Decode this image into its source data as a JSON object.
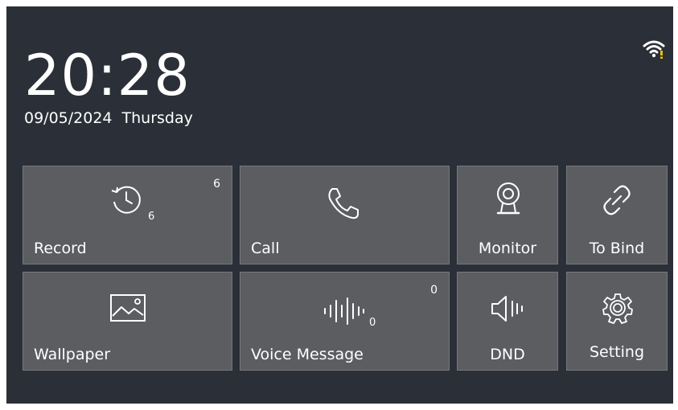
{
  "status": {
    "time": "20:28",
    "date": "09/05/2024",
    "weekday": "Thursday",
    "wifi_icon": "wifi-icon"
  },
  "tiles": {
    "record": {
      "label": "Record",
      "badge": "6",
      "icon_count": "6",
      "icon": "history-icon"
    },
    "call": {
      "label": "Call",
      "icon": "phone-icon"
    },
    "monitor": {
      "label": "Monitor",
      "icon": "camera-icon"
    },
    "to_bind": {
      "label": "To Bind",
      "icon": "link-icon"
    },
    "wallpaper": {
      "label": "Wallpaper",
      "icon": "image-icon"
    },
    "voice_message": {
      "label": "Voice Message",
      "badge": "0",
      "icon_count": "0",
      "icon": "waveform-icon"
    },
    "dnd": {
      "label": "DND",
      "icon": "speaker-mute-icon"
    },
    "setting": {
      "label": "Setting",
      "icon": "gear-icon"
    }
  },
  "colors": {
    "background": "#2b2f37",
    "tile": "#5b5d61",
    "tile_border": "#76787c",
    "text": "#ffffff",
    "wifi_accent": "#e6c200"
  }
}
